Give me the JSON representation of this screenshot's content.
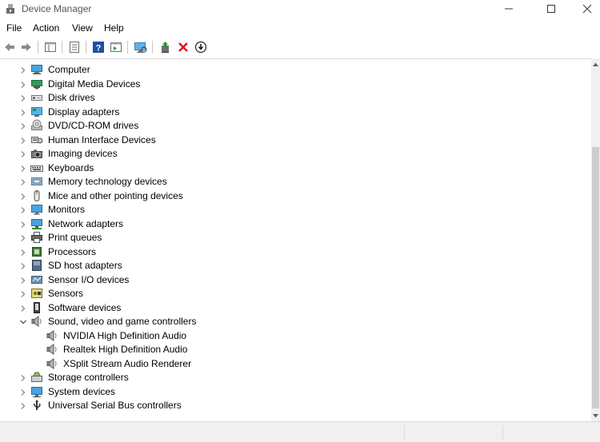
{
  "window": {
    "title": "Device Manager",
    "controls": [
      "minimize",
      "maximize",
      "close"
    ]
  },
  "menu": {
    "items": [
      "File",
      "Action",
      "View",
      "Help"
    ]
  },
  "toolbar": {
    "buttons": [
      "back-icon",
      "forward-icon",
      "show-hide-tree-icon",
      "properties-icon",
      "help-icon",
      "action-pane-icon",
      "scan-hardware-icon",
      "update-driver-icon",
      "uninstall-icon",
      "disable-device-icon"
    ]
  },
  "tree": {
    "items": [
      {
        "label": "Computer",
        "expanded": false,
        "icon": "computer-icon"
      },
      {
        "label": "Digital Media Devices",
        "expanded": false,
        "icon": "media-device-icon"
      },
      {
        "label": "Disk drives",
        "expanded": false,
        "icon": "disk-drive-icon"
      },
      {
        "label": "Display adapters",
        "expanded": false,
        "icon": "display-adapter-icon"
      },
      {
        "label": "DVD/CD-ROM drives",
        "expanded": false,
        "icon": "dvd-icon"
      },
      {
        "label": "Human Interface Devices",
        "expanded": false,
        "icon": "hid-icon"
      },
      {
        "label": "Imaging devices",
        "expanded": false,
        "icon": "camera-icon"
      },
      {
        "label": "Keyboards",
        "expanded": false,
        "icon": "keyboard-icon"
      },
      {
        "label": "Memory technology devices",
        "expanded": false,
        "icon": "memory-icon"
      },
      {
        "label": "Mice and other pointing devices",
        "expanded": false,
        "icon": "mouse-icon"
      },
      {
        "label": "Monitors",
        "expanded": false,
        "icon": "monitor-icon"
      },
      {
        "label": "Network adapters",
        "expanded": false,
        "icon": "network-icon"
      },
      {
        "label": "Print queues",
        "expanded": false,
        "icon": "printer-icon"
      },
      {
        "label": "Processors",
        "expanded": false,
        "icon": "processor-icon"
      },
      {
        "label": "SD host adapters",
        "expanded": false,
        "icon": "sd-card-icon"
      },
      {
        "label": "Sensor I/O devices",
        "expanded": false,
        "icon": "sensor-io-icon"
      },
      {
        "label": "Sensors",
        "expanded": false,
        "icon": "sensor-icon"
      },
      {
        "label": "Software devices",
        "expanded": false,
        "icon": "software-device-icon"
      },
      {
        "label": "Sound, video and game controllers",
        "expanded": true,
        "icon": "speaker-icon"
      },
      {
        "label": "NVIDIA High Definition Audio",
        "child": true,
        "icon": "speaker-icon"
      },
      {
        "label": "Realtek High Definition Audio",
        "child": true,
        "icon": "speaker-icon"
      },
      {
        "label": "XSplit  Stream  Audio  Renderer",
        "child": true,
        "icon": "speaker-icon"
      },
      {
        "label": "Storage controllers",
        "expanded": false,
        "icon": "storage-controller-icon"
      },
      {
        "label": "System devices",
        "expanded": false,
        "icon": "system-device-icon"
      },
      {
        "label": "Universal Serial Bus controllers",
        "expanded": false,
        "icon": "usb-icon"
      }
    ]
  },
  "colors": {
    "accent_blue": "#1e73be",
    "delete_red": "#e81123",
    "scan_green": "#2f8f2f"
  }
}
